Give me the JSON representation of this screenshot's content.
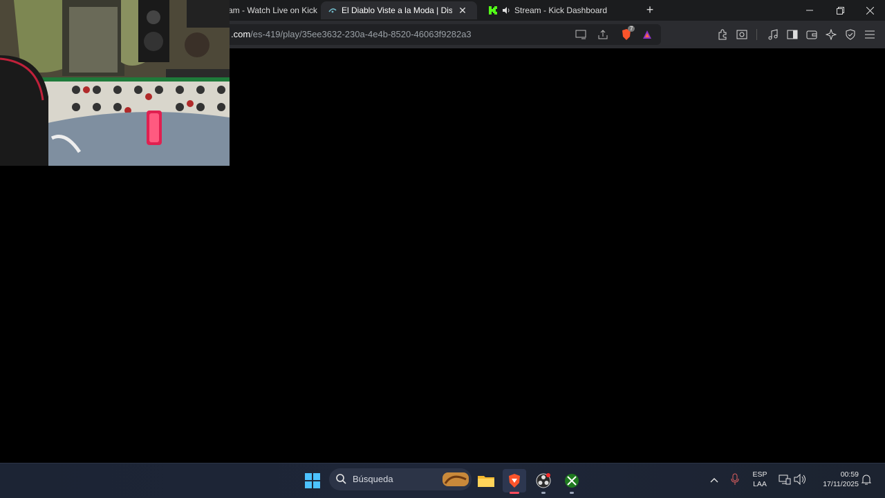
{
  "browser": {
    "tabs": [
      {
        "title": "am - Watch Live on Kick",
        "active": false
      },
      {
        "title": "El Diablo Viste a la Moda | Disne",
        "active": true
      },
      {
        "title": "Stream - Kick Dashboard",
        "active": false,
        "audio": true
      }
    ],
    "new_tab_label": "+",
    "address": {
      "domain": ".com",
      "path": "/es-419/play/35ee3632-230a-4e4b-8520-46063f9282a3"
    },
    "shield_badge": "7"
  },
  "taskbar": {
    "search_placeholder": "Búsqueda",
    "language_top": "ESP",
    "language_bottom": "LAA",
    "time": "00:59",
    "date": "17/11/2025"
  },
  "icons": {
    "kick": "kick-logo-icon",
    "brave": "brave-icon",
    "windows": "windows-start-icon"
  },
  "colors": {
    "kick_green": "#53fc18",
    "brave_orange": "#fb542b",
    "windows_blue": "#4cc2ff"
  }
}
